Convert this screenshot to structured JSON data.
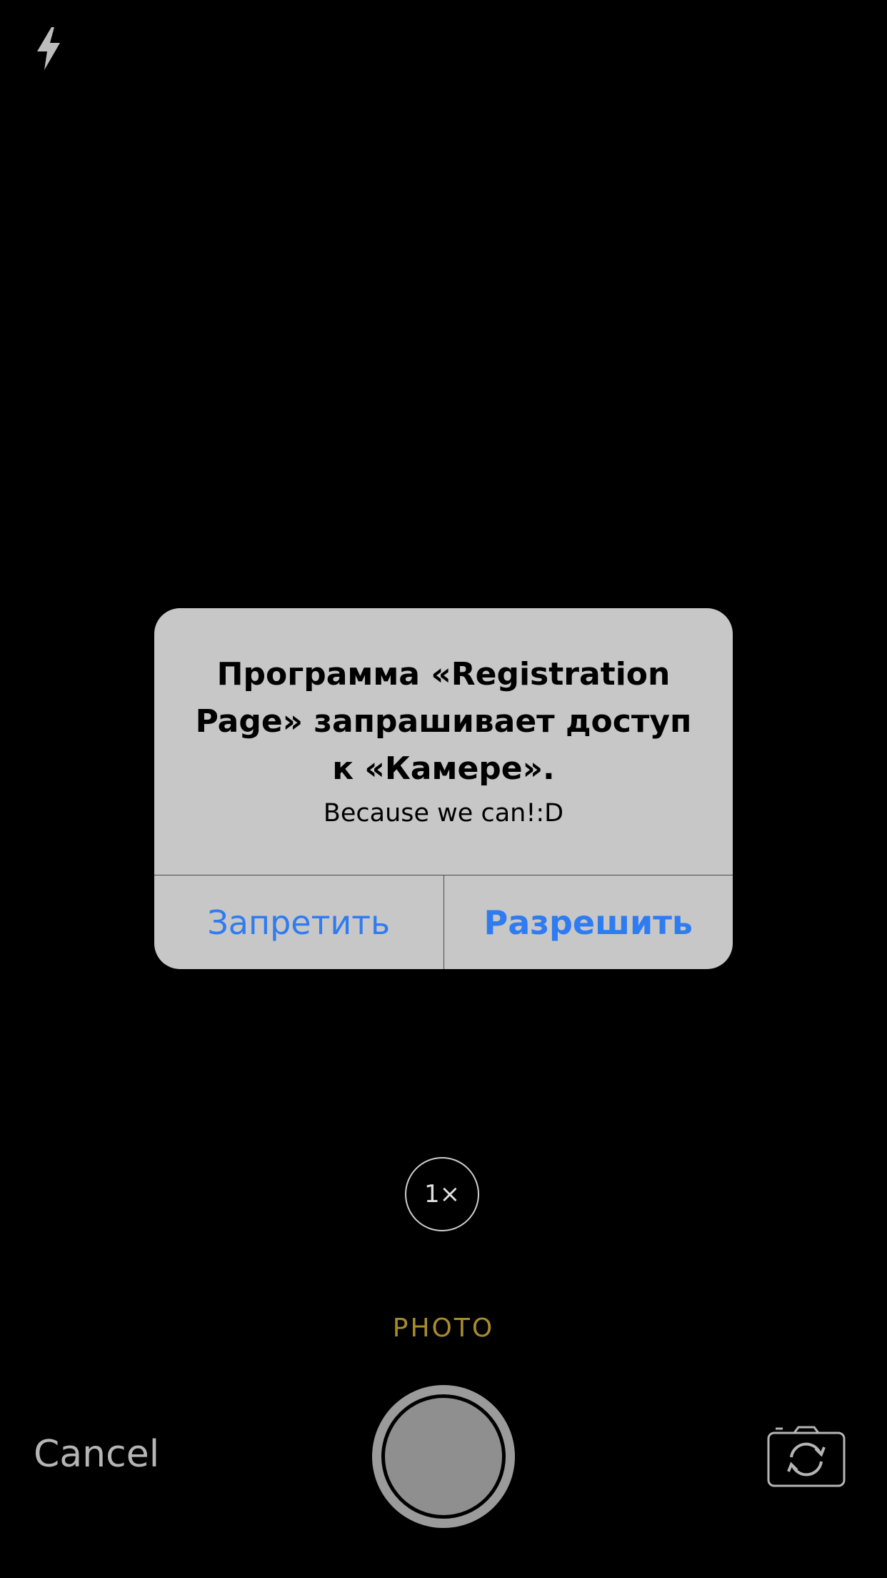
{
  "camera": {
    "flash_icon": "lightning-bolt-icon",
    "zoom_label": "1×",
    "mode_label": "PHOTO",
    "cancel_label": "Cancel",
    "flip_icon": "camera-switch-icon"
  },
  "alert": {
    "title": "Программа «Registration Page» запрашивает доступ к «Камере».",
    "message": "Because we can!:D",
    "deny_label": "Запретить",
    "allow_label": "Разрешить",
    "action_color": "#2f7bf0"
  },
  "colors": {
    "background": "#000000",
    "dialog_bg": "#c7c7c7",
    "mode_accent": "#a78b2c"
  }
}
